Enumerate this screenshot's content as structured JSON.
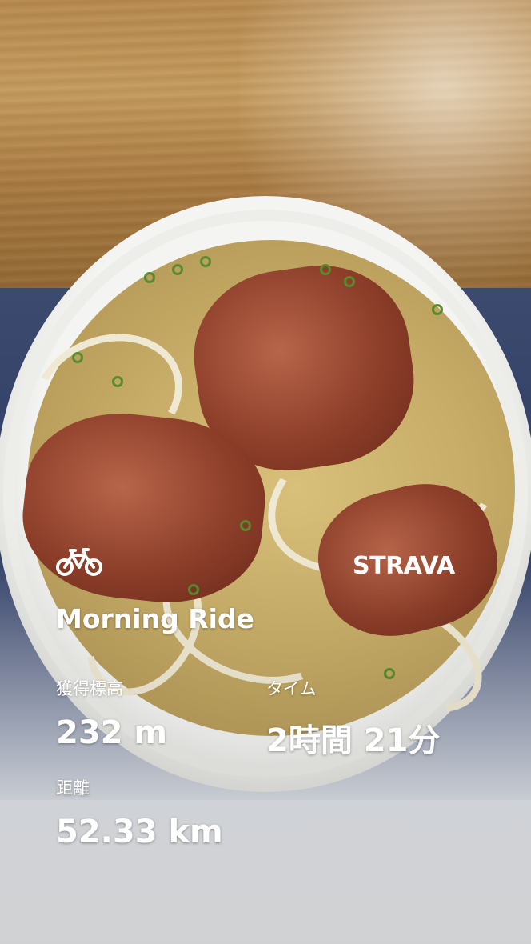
{
  "activity": {
    "type_icon": "bicycle-icon",
    "title": "Morning Ride"
  },
  "brand": {
    "name": "STRAVA",
    "color": "#ffffff"
  },
  "stats": {
    "elevation": {
      "label": "獲得標高",
      "value": "232 m"
    },
    "time": {
      "label": "タイム",
      "value": "2時間 21分"
    },
    "distance": {
      "label": "距離",
      "value": "52.33 km"
    }
  },
  "colors": {
    "overlay_text": "#ffffff"
  }
}
